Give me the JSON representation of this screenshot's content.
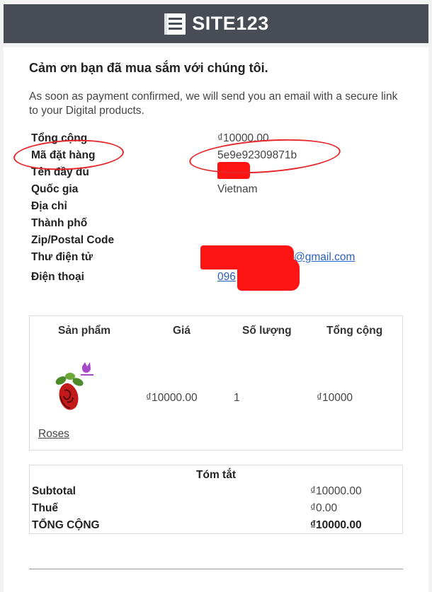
{
  "header": {
    "logo_text": "SITE123"
  },
  "order": {
    "title": "Cảm ơn bạn đã mua sắm với chúng tôi.",
    "message": "As soon as payment confirmed, we will send you an email with a secure link to your Digital products.",
    "info": [
      {
        "label": "Tổng cộng",
        "value": "₫10000.00"
      },
      {
        "label": "Mã đặt hàng",
        "value": "5e9e92309871b"
      },
      {
        "label": "Tên đầy đủ",
        "value": ""
      },
      {
        "label": "Quốc gia",
        "value": "Vietnam"
      },
      {
        "label": "Địa chỉ",
        "value": ""
      },
      {
        "label": "Thành phố",
        "value": ""
      },
      {
        "label": "Zip/Postal Code",
        "value": ""
      },
      {
        "label": "Thư điện tử",
        "value": "@gmail.com"
      },
      {
        "label": "Điện thoại",
        "value": "096"
      }
    ]
  },
  "products": {
    "headers": [
      "Sản phẩm",
      "Giá",
      "Số lượng",
      "Tổng cộng"
    ],
    "rows": [
      {
        "name": "Roses",
        "price": "₫10000.00",
        "quantity": "1",
        "total": "₫10000"
      }
    ]
  },
  "summary": {
    "title": "Tóm tắt",
    "rows": [
      {
        "label": "Subtotal",
        "value": "₫10000.00"
      },
      {
        "label": "Thuế",
        "value": "₫0.00"
      },
      {
        "label": "TỔNG CỘNG",
        "value": "₫10000.00"
      }
    ]
  },
  "colors": {
    "header_bg": "#474c55",
    "link": "#2a5fbd",
    "annotation_red": "#e5262a"
  }
}
